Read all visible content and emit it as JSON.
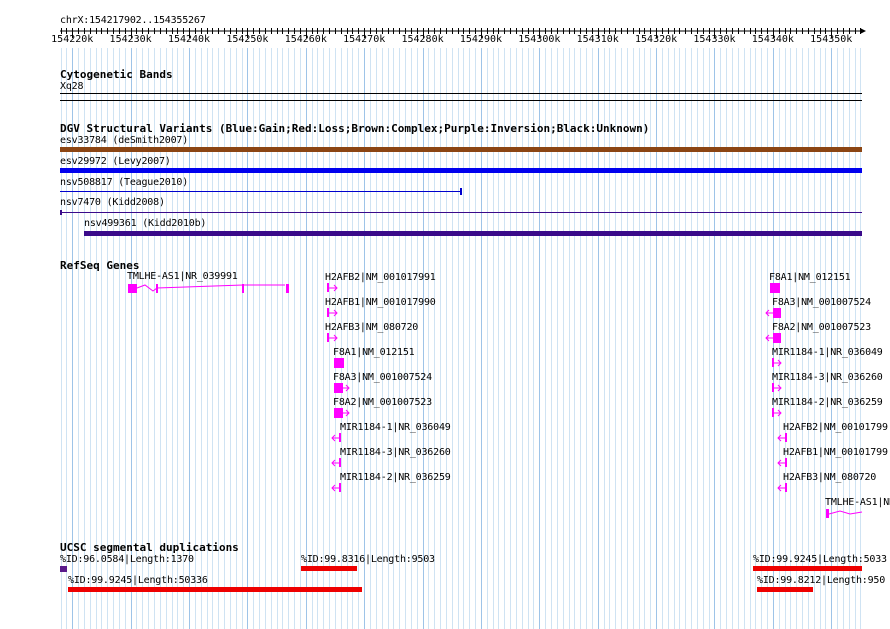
{
  "location": "chrX:154217902..154355267",
  "ruler": {
    "start": 154217902,
    "end": 154355267,
    "ticks": [
      "154220k",
      "154230k",
      "154240k",
      "154250k",
      "154260k",
      "154270k",
      "154280k",
      "154290k",
      "154300k",
      "154310k",
      "154320k",
      "154330k",
      "154340k",
      "154350k"
    ]
  },
  "tracks": {
    "cytoband": {
      "title": "Cytogenetic Bands",
      "band": "Xq28"
    },
    "dgv": {
      "title": "DGV Structural Variants (Blue:Gain;Red:Loss;Brown:Complex;Purple:Inversion;Black:Unknown)",
      "items": [
        {
          "label": "esv33784 (deSmith2007)",
          "color": "#8B4513"
        },
        {
          "label": "esv29972 (Levy2007)",
          "color": "#0000ee"
        },
        {
          "label": "nsv508817 (Teague2010)",
          "color": "#0000cc"
        },
        {
          "label": "nsv7470 (Kidd2008)",
          "color": "#3a0a8a"
        },
        {
          "label": "nsv499361 (Kidd2010b)",
          "color": "#3a0a8a"
        }
      ]
    },
    "refseq": {
      "title": "RefSeq Genes",
      "color": "#ff00ff",
      "left_group": [
        "TMLHE-AS1|NR_039991"
      ],
      "mid_group": [
        "H2AFB2|NM_001017991",
        "H2AFB1|NM_001017990",
        "H2AFB3|NM_080720",
        "F8A1|NM_012151",
        "F8A3|NM_001007524",
        "F8A2|NM_001007523",
        "MIR1184-1|NR_036049",
        "MIR1184-3|NR_036260",
        "MIR1184-2|NR_036259"
      ],
      "right_group": [
        "F8A1|NM_012151",
        "F8A3|NM_001007524",
        "F8A2|NM_001007523",
        "MIR1184-1|NR_036049",
        "MIR1184-3|NR_036260",
        "MIR1184-2|NR_036259",
        "H2AFB2|NM_00101799",
        "H2AFB1|NM_00101799",
        "H2AFB3|NM_080720",
        "TMLHE-AS1|NR"
      ]
    },
    "segdups": {
      "title": "UCSC segmental duplications",
      "color": "#ee0000",
      "items": [
        {
          "label": "%ID:96.0584|Length:1370"
        },
        {
          "label": "%ID:99.8316|Length:9503"
        },
        {
          "label": "%ID:99.9245|Length:50336"
        },
        {
          "label": "%ID:99.9245|Length:5033"
        },
        {
          "label": "%ID:99.8212|Length:950"
        }
      ]
    }
  }
}
